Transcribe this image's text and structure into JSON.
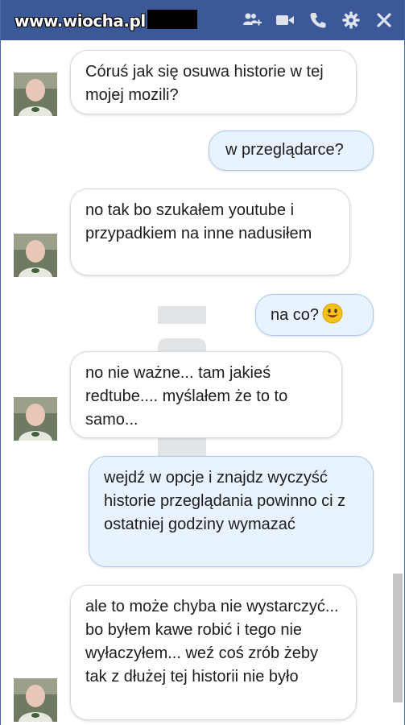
{
  "watermark": "www.wiocha.pl",
  "header": {
    "icons": [
      "add-people-icon",
      "video-call-icon",
      "phone-icon",
      "gear-icon",
      "close-icon"
    ],
    "bg_color": "#3b5998"
  },
  "messages": [
    {
      "from": "them",
      "text": "Córuś jak się osuwa historie w tej mojej mozili?"
    },
    {
      "from": "me",
      "text": "w przeglądarce?"
    },
    {
      "from": "them",
      "text": "no tak bo szukałem youtube i przypadkiem na inne nadusiłem"
    },
    {
      "from": "me",
      "text": "na co?",
      "emoji": "smile-emoji-icon"
    },
    {
      "from": "them",
      "text": "no nie ważne... tam jakieś redtube.... myślałem że to to samo..."
    },
    {
      "from": "me",
      "text": "wejdź w opcje i znajdz wyczyść historie przeglądania powinno ci z ostatniej godziny wymazać"
    },
    {
      "from": "them",
      "text": "ale to może chyba nie wystarczyć... bo byłem kawe robić i tego nie wyłaczyłem... weź coś zrób żeby tak z dłużej tej historii nie było"
    }
  ]
}
